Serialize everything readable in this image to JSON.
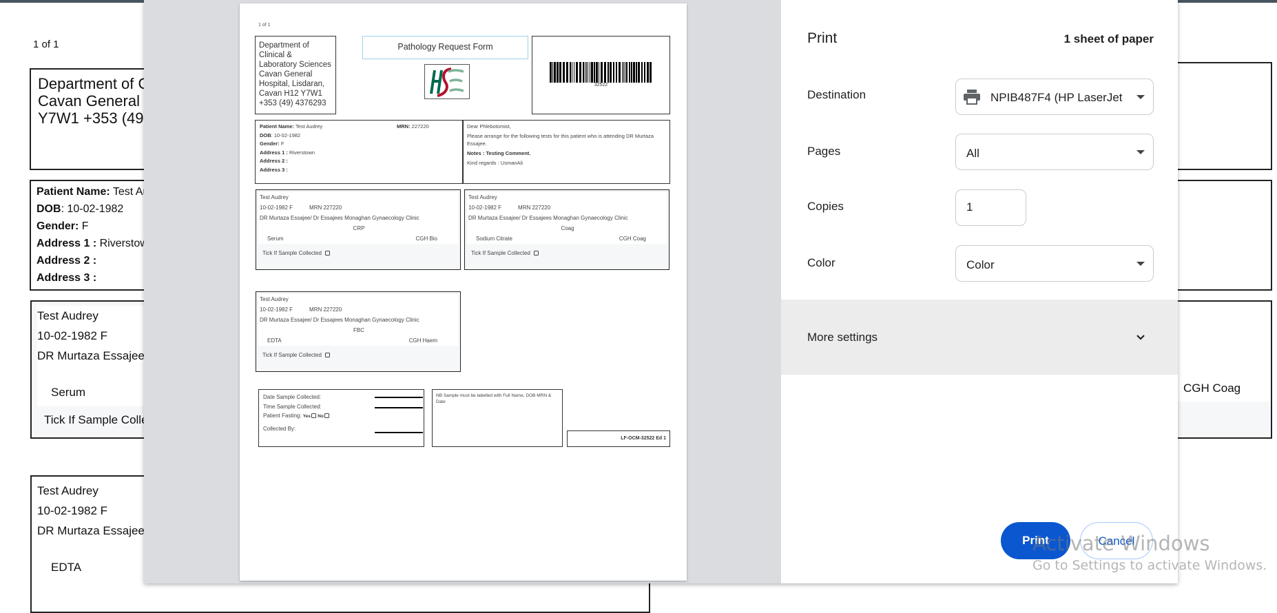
{
  "page_count": "1 of 1",
  "department": "Department of Clinical & Laboratory Sciences Cavan General Hospital, Lisdaran, Cavan H12 Y7W1 +353 (49) 4376293",
  "form_title": "Pathology Request Form",
  "logo_text": "HSE",
  "barcode_number": "32522",
  "patient": {
    "name_label": "Patient Name:",
    "name": "Test Audrey",
    "mrn_label": "MRN:",
    "mrn": "227220",
    "dob_label": "DOB",
    "dob": "10-02-1982",
    "gender_label": "Gender:",
    "gender": "F",
    "address1_label": "Address 1 :",
    "address1": "Riverstown",
    "address2_label": "Address 2 :",
    "address3_label": "Address 3 :"
  },
  "letter": {
    "greeting": "Dear Phlebotomist,",
    "body": "Please arrange for the following tests for this patient who is attending DR Murtaza Essajee.",
    "notes": "Notes : Testing Comment.",
    "regards": "Kind regards : UsmanAli"
  },
  "sample_common": {
    "name": "Test Audrey",
    "dob_gender": "10-02-1982 F",
    "mrn": "MRN 227220",
    "clinic": "DR Murtaza Essajee/ Dr Essajees Monaghan Gynaecology Clinic",
    "tick_label": "Tick If Sample Collected"
  },
  "samples": [
    {
      "test": "CRP",
      "tube": "Serum",
      "lab": "CGH Bio"
    },
    {
      "test": "Coag",
      "tube": "Sodium Citrate",
      "lab": "CGH Coag"
    },
    {
      "test": "FBC",
      "tube": "EDTA",
      "lab": "CGH Haem"
    }
  ],
  "collection": {
    "date_label": "Date Sample Collected:",
    "time_label": "Time Sample Collected:",
    "fasting_label": "Patient Fasting:",
    "yes": "Yes",
    "no": "No",
    "collected_by": "Collected By:"
  },
  "nb_note": "NB Sample must be labelled with Full Name, DOB MRN & Date",
  "form_code": "LF-OCM-32522 Ed 1",
  "print_dialog": {
    "title": "Print",
    "sheets": "1 sheet of paper",
    "destination_label": "Destination",
    "destination_value": "NPIB487F4 (HP LaserJet",
    "pages_label": "Pages",
    "pages_value": "All",
    "copies_label": "Copies",
    "copies_value": "1",
    "color_label": "Color",
    "color_value": "Color",
    "more_settings": "More settings",
    "print_button": "Print",
    "cancel_button": "Cancel",
    "accent_color": "#0b57d0"
  },
  "watermark": {
    "line1": "Activate Windows",
    "line2": "Go to Settings to activate Windows."
  }
}
